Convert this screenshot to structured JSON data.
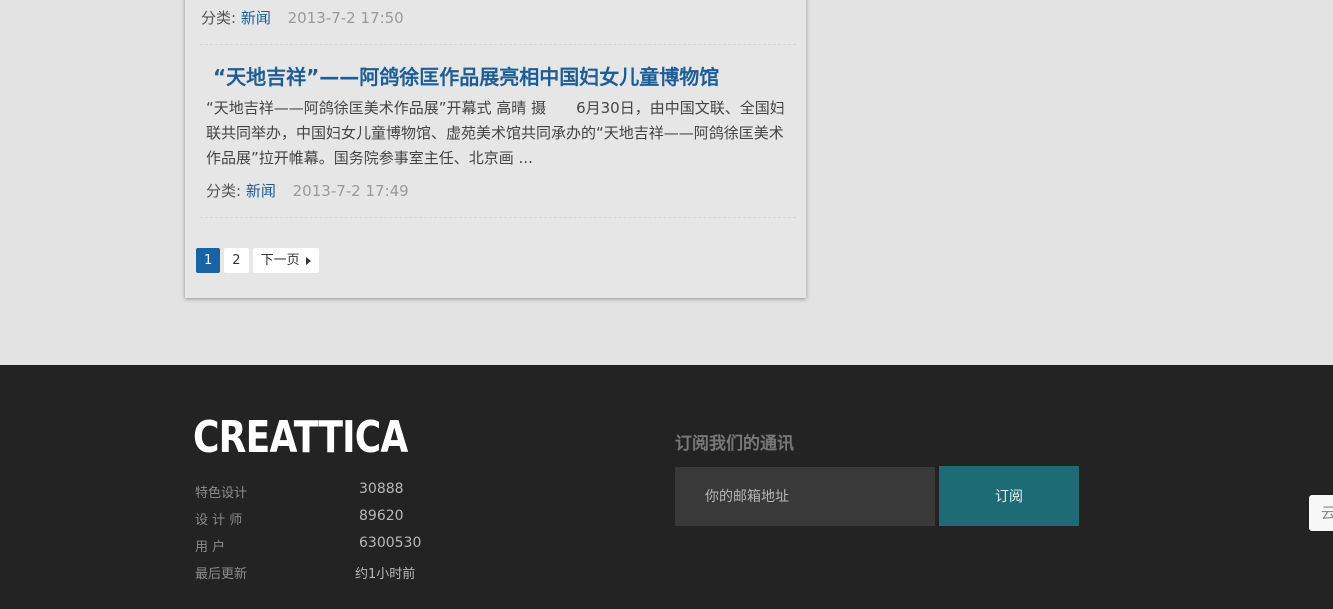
{
  "prev_post": {
    "category_label": "分类:",
    "category": "新闻",
    "date": "2013-7-2 17:50"
  },
  "post": {
    "title": "“天地吉祥”——阿鸽徐匡作品展亮相中国妇女儿童博物馆",
    "excerpt": "“天地吉祥——阿鸽徐匡美术作品展”开幕式 高晴 摄　　6月30日，由中国文联、全国妇联共同举办，中国妇女儿童博物馆、虚苑美术馆共同承办的“天地吉祥——阿鸽徐匡美术作品展”拉开帷幕。国务院参事室主任、北京画 ...",
    "category_label": "分类:",
    "category": "新闻",
    "date": "2013-7-2 17:49"
  },
  "pagination": {
    "pages": [
      "1",
      "2"
    ],
    "current": "1",
    "next_label": "下一页"
  },
  "footer": {
    "logo": "CREATTICA",
    "stats": [
      {
        "label": "特色设计",
        "value": "30888"
      },
      {
        "label": "设 计 师",
        "value": "89620"
      },
      {
        "label": "用 户",
        "value": "6300530"
      },
      {
        "label": "最后更新",
        "value": "约1小时前"
      }
    ],
    "newsletter": {
      "title": "订阅我们的通讯",
      "placeholder": "你的邮箱地址",
      "button": "订阅"
    }
  },
  "side_tab": {
    "glyph": "云"
  }
}
